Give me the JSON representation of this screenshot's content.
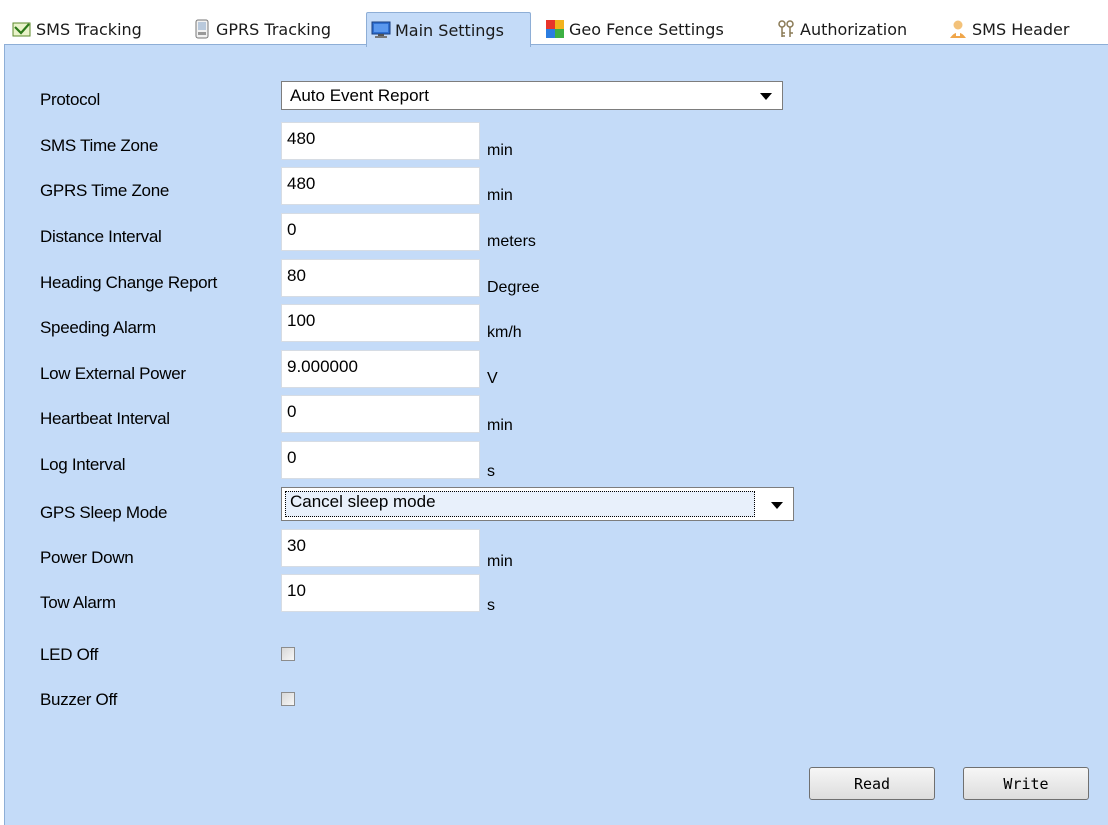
{
  "tabs": [
    {
      "label": "SMS Tracking",
      "icon": "sms-tracking-icon"
    },
    {
      "label": "GPRS Tracking",
      "icon": "gprs-tracking-icon"
    },
    {
      "label": "Main Settings",
      "icon": "monitor-icon",
      "active": true
    },
    {
      "label": "Geo Fence Settings",
      "icon": "geo-fence-icon"
    },
    {
      "label": "Authorization",
      "icon": "authorization-icon"
    },
    {
      "label": "SMS Header",
      "icon": "user-icon"
    }
  ],
  "settings": {
    "protocol": {
      "label": "Protocol",
      "value": "Auto Event Report"
    },
    "sms_time_zone": {
      "label": "SMS Time Zone",
      "value": "480",
      "unit": "min"
    },
    "gprs_time_zone": {
      "label": "GPRS Time Zone",
      "value": "480",
      "unit": "min"
    },
    "distance_interval": {
      "label": "Distance Interval",
      "value": "0",
      "unit": "meters"
    },
    "heading_change": {
      "label": "Heading Change Report",
      "value": "80",
      "unit": "Degree"
    },
    "speeding_alarm": {
      "label": "Speeding Alarm",
      "value": "100",
      "unit": "km/h"
    },
    "low_external_power": {
      "label": "Low External Power",
      "value": "9.000000",
      "unit": "V"
    },
    "heartbeat_interval": {
      "label": "Heartbeat Interval",
      "value": "0",
      "unit": "min"
    },
    "log_interval": {
      "label": "Log Interval",
      "value": "0",
      "unit": "s"
    },
    "gps_sleep_mode": {
      "label": "GPS Sleep Mode",
      "value": "Cancel sleep mode"
    },
    "power_down": {
      "label": "Power Down",
      "value": "30",
      "unit": "min"
    },
    "tow_alarm": {
      "label": "Tow Alarm",
      "value": "10",
      "unit": "s"
    },
    "led_off": {
      "label": "LED Off",
      "checked": false
    },
    "buzzer_off": {
      "label": "Buzzer Off",
      "checked": false
    }
  },
  "buttons": {
    "read": "Read",
    "write": "Write"
  },
  "colors": {
    "panel_bg": "#c4dbf8",
    "panel_border": "#8eaed6"
  }
}
